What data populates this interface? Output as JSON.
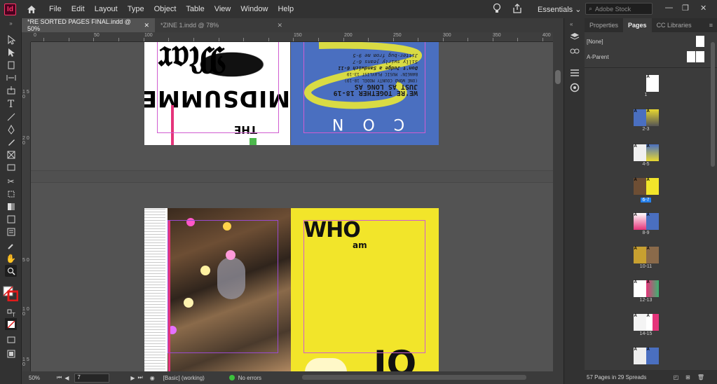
{
  "app": {
    "logo_text": "Id"
  },
  "menu": [
    "File",
    "Edit",
    "Layout",
    "Type",
    "Object",
    "Table",
    "View",
    "Window",
    "Help"
  ],
  "workspace": "Essentials",
  "search": {
    "placeholder": "Adobe Stock"
  },
  "tabs": [
    {
      "label": "*RE SORTED PAGES FINAL.indd @ 50%",
      "active": true
    },
    {
      "label": "*ZINE 1.indd @ 78%",
      "active": false
    }
  ],
  "ruler_h": [
    "0",
    "50",
    "100",
    "150",
    "200",
    "250",
    "300",
    "350",
    "400"
  ],
  "ruler_v": [
    "1\n5\n0",
    "2\n0\n0",
    "5\n0",
    "1\n0\n0",
    "1\n5\n0"
  ],
  "spread1": {
    "left": {
      "text_midsummer": "MIDSUMMER",
      "text_the": "THE"
    },
    "right": {
      "text_con": "C O N",
      "lines": [
        "WE'RE TOGETHER 18-19",
        "JUST AS LONG AS",
        "(ONE WORD COUNTY MODEL 18-19)",
        "BANGIN' MUSIC PLAYLIST 13-19",
        "Don't Judge a Sandwich 6-11",
        "Silly swirly jeans 6-7",
        "Jitter-bug from me 9-5"
      ]
    }
  },
  "spread2": {
    "right": {
      "text_who": "WHO",
      "text_am": "am",
      "text_big": "IQ"
    }
  },
  "status": {
    "zoom": "50%",
    "page": "7",
    "style": "[Basic] (working)",
    "preflight": "No errors"
  },
  "panel": {
    "tabs": [
      "Properties",
      "Pages",
      "CC Libraries"
    ],
    "active_tab": "Pages",
    "masters": [
      "[None]",
      "A-Parent"
    ],
    "spreads": [
      "1",
      "2-3",
      "4-5",
      "6-7",
      "8-9",
      "10-11",
      "12-13",
      "14-15"
    ],
    "selected_spread": "6-7",
    "footer": "57 Pages in 29 Spreads"
  }
}
